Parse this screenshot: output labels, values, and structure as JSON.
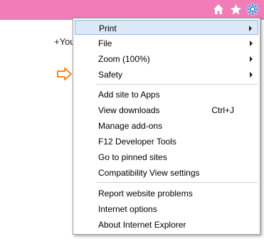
{
  "toolbar": {
    "icons": [
      "home-icon",
      "favorites-star-icon",
      "tools-gear-icon"
    ],
    "colors": {
      "bar": "#f07cb8",
      "icon": "#ffffff"
    }
  },
  "page": {
    "fragment_text": "+You"
  },
  "menu": {
    "groups": [
      [
        {
          "label": "Print",
          "submenu": true,
          "highlighted": true
        },
        {
          "label": "File",
          "submenu": true
        },
        {
          "label": "Zoom (100%)",
          "submenu": true
        },
        {
          "label": "Safety",
          "submenu": true
        }
      ],
      [
        {
          "label": "Add site to Apps"
        },
        {
          "label": "View downloads",
          "accelerator": "Ctrl+J"
        },
        {
          "label": "Manage add-ons"
        },
        {
          "label": "F12 Developer Tools"
        },
        {
          "label": "Go to pinned sites"
        },
        {
          "label": "Compatibility View settings"
        }
      ],
      [
        {
          "label": "Report website problems"
        },
        {
          "label": "Internet options"
        },
        {
          "label": "About Internet Explorer"
        }
      ]
    ],
    "colors": {
      "highlight_bg": "#dbe8f8",
      "highlight_border": "#98b8e0"
    }
  },
  "annotation": {
    "icon": "arrow-right-icon",
    "color": "#f08a24"
  }
}
